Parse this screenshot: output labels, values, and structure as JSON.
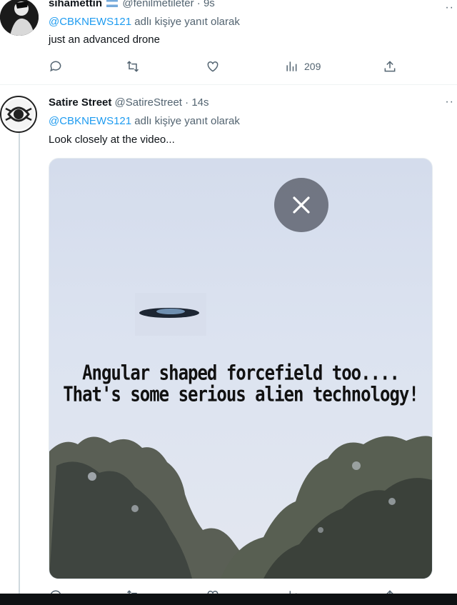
{
  "tweets": [
    {
      "name": "sihamettin",
      "handle": "@fenilmetileter",
      "time": "· 9s",
      "reply_mention": "@CBKNEWS121",
      "reply_suffix": " adlı kişiye yanıt olarak",
      "text": "just an advanced drone",
      "views": "209"
    },
    {
      "name": "Satire Street",
      "handle": "@SatireStreet",
      "time": "· 14s",
      "reply_mention": "@CBKNEWS121",
      "reply_suffix": " adlı kişiye yanıt olarak",
      "text": "Look closely at the video...",
      "media": {
        "caption_line1": "Angular shaped forcefield too....",
        "caption_line2": "That's some serious alien technology!"
      }
    }
  ],
  "icons": {
    "reply": "reply-icon",
    "retweet": "retweet-icon",
    "like": "heart-icon",
    "views": "views-icon",
    "share": "share-icon",
    "more": "more-icon",
    "close": "close-icon"
  },
  "colors": {
    "mention": "#1d9bf0",
    "secondary": "#536471",
    "media_close_bg": "#5f6470"
  }
}
